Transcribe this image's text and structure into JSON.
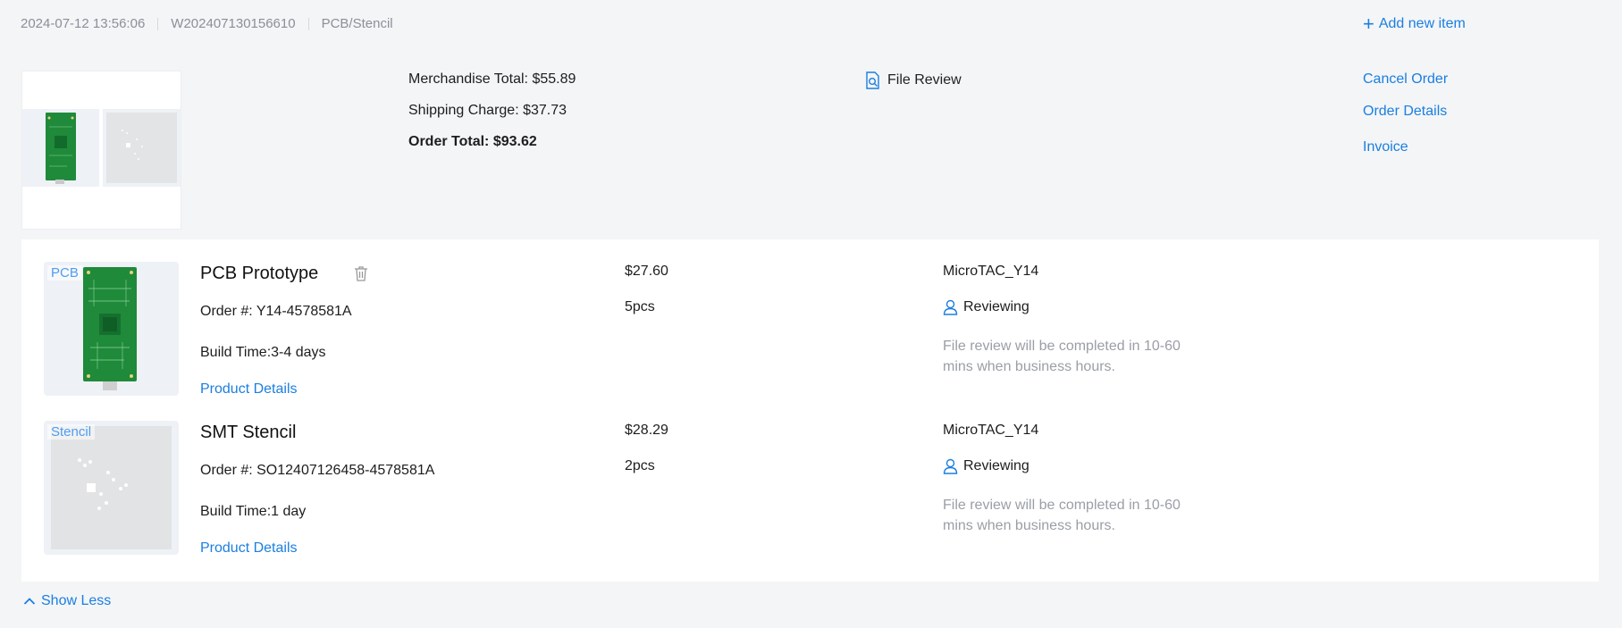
{
  "header": {
    "datetime": "2024-07-12 13:56:06",
    "order_id": "W202407130156610",
    "category": "PCB/Stencil",
    "add_new_label": "Add new item"
  },
  "summary": {
    "merchandise_total": "Merchandise Total: $55.89",
    "shipping_charge": "Shipping Charge: $37.73",
    "order_total": "Order Total: $93.62"
  },
  "file_review": {
    "label": "File Review",
    "icon": "file-search-icon"
  },
  "actions": {
    "cancel_order": "Cancel Order",
    "order_details": "Order Details",
    "invoice": "Invoice"
  },
  "items": [
    {
      "tag": "PCB",
      "name": "PCB Prototype",
      "order_no": "Order #: Y14-4578581A",
      "build_time": "Build Time:3-4 days",
      "details_link": "Product Details",
      "price": "$27.60",
      "qty": "5pcs",
      "user": "MicroTAC_Y14",
      "status": "Reviewing",
      "note": "File review will be completed in 10-60 mins when business hours."
    },
    {
      "tag": "Stencil",
      "name": "SMT Stencil",
      "order_no": "Order #: SO12407126458-4578581A",
      "build_time": "Build Time:1 day",
      "details_link": "Product Details",
      "price": "$28.29",
      "qty": "2pcs",
      "user": "MicroTAC_Y14",
      "status": "Reviewing",
      "note": "File review will be completed in 10-60 mins when business hours."
    }
  ],
  "footer": {
    "show_less_label": "Show Less"
  },
  "colors": {
    "accent": "#1a7fe0",
    "panel_bg": "#f4f5f7",
    "pcb_green": "#1f8a3a",
    "muted_text": "#9a9ea6"
  }
}
